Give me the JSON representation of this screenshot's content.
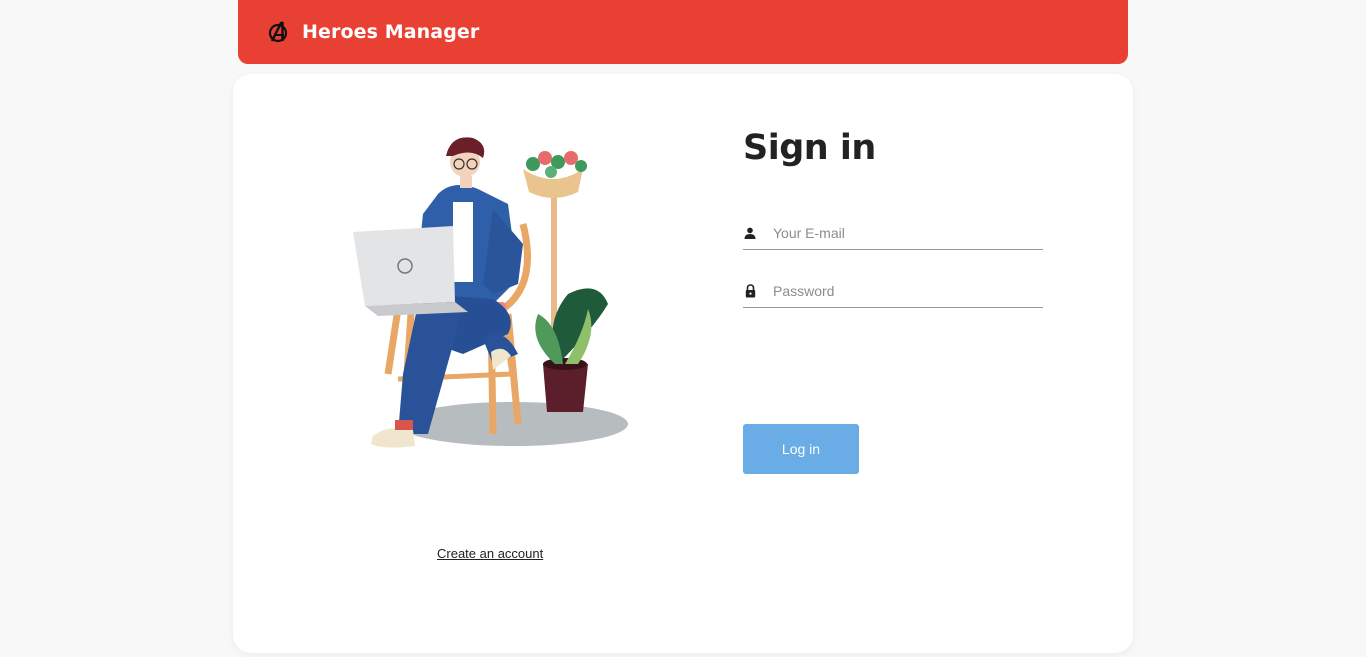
{
  "header": {
    "brand_title": "Heroes Manager",
    "brand_icon": "avengers-logo-icon",
    "background_color": "#e84133"
  },
  "signin": {
    "title": "Sign in",
    "email": {
      "placeholder": "Your E-mail",
      "value": "",
      "icon": "person-icon"
    },
    "password": {
      "placeholder": "Password",
      "value": "",
      "icon": "lock-icon"
    },
    "login_label": "Log in",
    "login_color": "#6aace6"
  },
  "left": {
    "illustration": "man-with-laptop-illustration",
    "create_account_label": "Create an account"
  }
}
